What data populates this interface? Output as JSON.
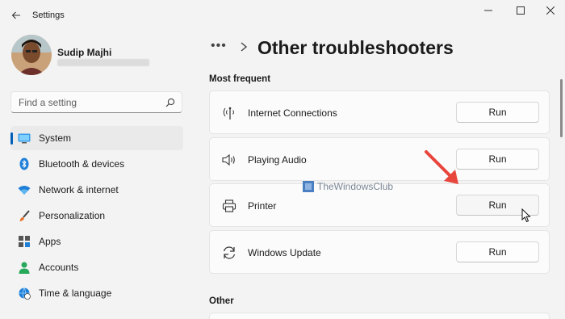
{
  "window": {
    "title": "Settings"
  },
  "profile": {
    "name": "Sudip Majhi"
  },
  "search": {
    "placeholder": "Find a setting"
  },
  "sidebar": {
    "items": [
      {
        "label": "System",
        "icon": "monitor-icon",
        "selected": true
      },
      {
        "label": "Bluetooth & devices",
        "icon": "bluetooth-icon"
      },
      {
        "label": "Network & internet",
        "icon": "wifi-icon"
      },
      {
        "label": "Personalization",
        "icon": "brush-icon"
      },
      {
        "label": "Apps",
        "icon": "apps-icon"
      },
      {
        "label": "Accounts",
        "icon": "person-icon"
      },
      {
        "label": "Time & language",
        "icon": "globe-clock-icon"
      }
    ]
  },
  "breadcrumb": {
    "ellipsis": "•••",
    "title": "Other troubleshooters"
  },
  "sections": {
    "most_frequent": "Most frequent",
    "other": "Other"
  },
  "troubleshooters": [
    {
      "label": "Internet Connections",
      "icon": "wifi-antenna-icon",
      "button": "Run"
    },
    {
      "label": "Playing Audio",
      "icon": "speaker-icon",
      "button": "Run"
    },
    {
      "label": "Printer",
      "icon": "printer-icon",
      "button": "Run"
    },
    {
      "label": "Windows Update",
      "icon": "sync-icon",
      "button": "Run"
    }
  ],
  "watermark": {
    "text": "TheWindowsClub"
  },
  "colors": {
    "accent": "#005fb8",
    "arrow": "#e8453c"
  }
}
